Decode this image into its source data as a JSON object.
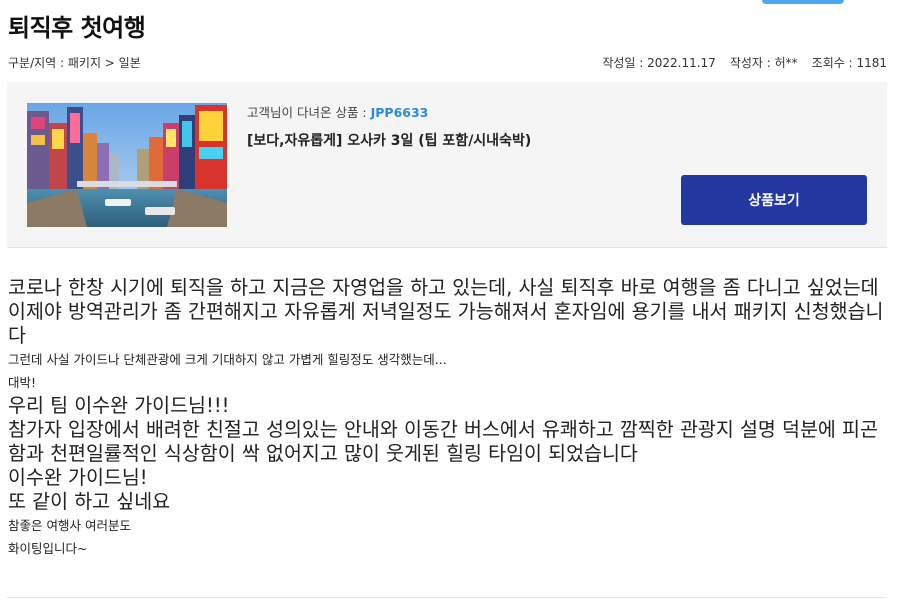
{
  "post": {
    "title": "퇴직후 첫여행",
    "breadcrumb": "구분/지역 : 패키지 > 일본",
    "date": "작성일 : 2022.11.17",
    "author": "작성자 : 허**",
    "views": "조회수 : 1181"
  },
  "product": {
    "code_label": "고객님이 다녀온 상품 : ",
    "code": "JPP6633",
    "name": "[보다,자유롭게] 오사카 3일 (팁 포함/시내숙박)",
    "button_label": "상품보기"
  },
  "body": [
    {
      "size": "big",
      "text": "코로나 한창 시기에 퇴직을 하고 지금은 자영업을 하고 있는데, 사실 퇴직후 바로 여행을 좀 다니고 싶었는데 이제야 방역관리가 좀 간편해지고 자유롭게 저녁일정도 가능해져서 혼자임에 용기를 내서 패키지 신청했습니다"
    },
    {
      "size": "small",
      "text": "그런데 사실 가이드나 단체관광에 크게 기대하지 않고 가볍게 힐링정도 생각했는데..."
    },
    {
      "size": "small",
      "text": "대박!"
    },
    {
      "size": "big",
      "text": "우리 팀 이수완 가이드님!!!"
    },
    {
      "size": "big",
      "text": "참가자 입장에서 배려한 친절고 성의있는 안내와 이동간 버스에서 유쾌하고 깜찍한 관광지 설명 덕분에 피곤함과 천편일률적인 식상함이 싹 없어지고 많이 웃게된 힐링 타임이 되었습니다"
    },
    {
      "size": "big",
      "text": "이수완  가이드님!"
    },
    {
      "size": "big",
      "text": "또 같이 하고 싶네요"
    },
    {
      "size": "small",
      "text": "참좋은 여행사 여러분도"
    },
    {
      "size": "small",
      "text": "화이팅입니다~"
    }
  ],
  "colors": {
    "accent": "#2a8be0",
    "button": "#2436a0",
    "box_bg": "#f5f5f5"
  }
}
